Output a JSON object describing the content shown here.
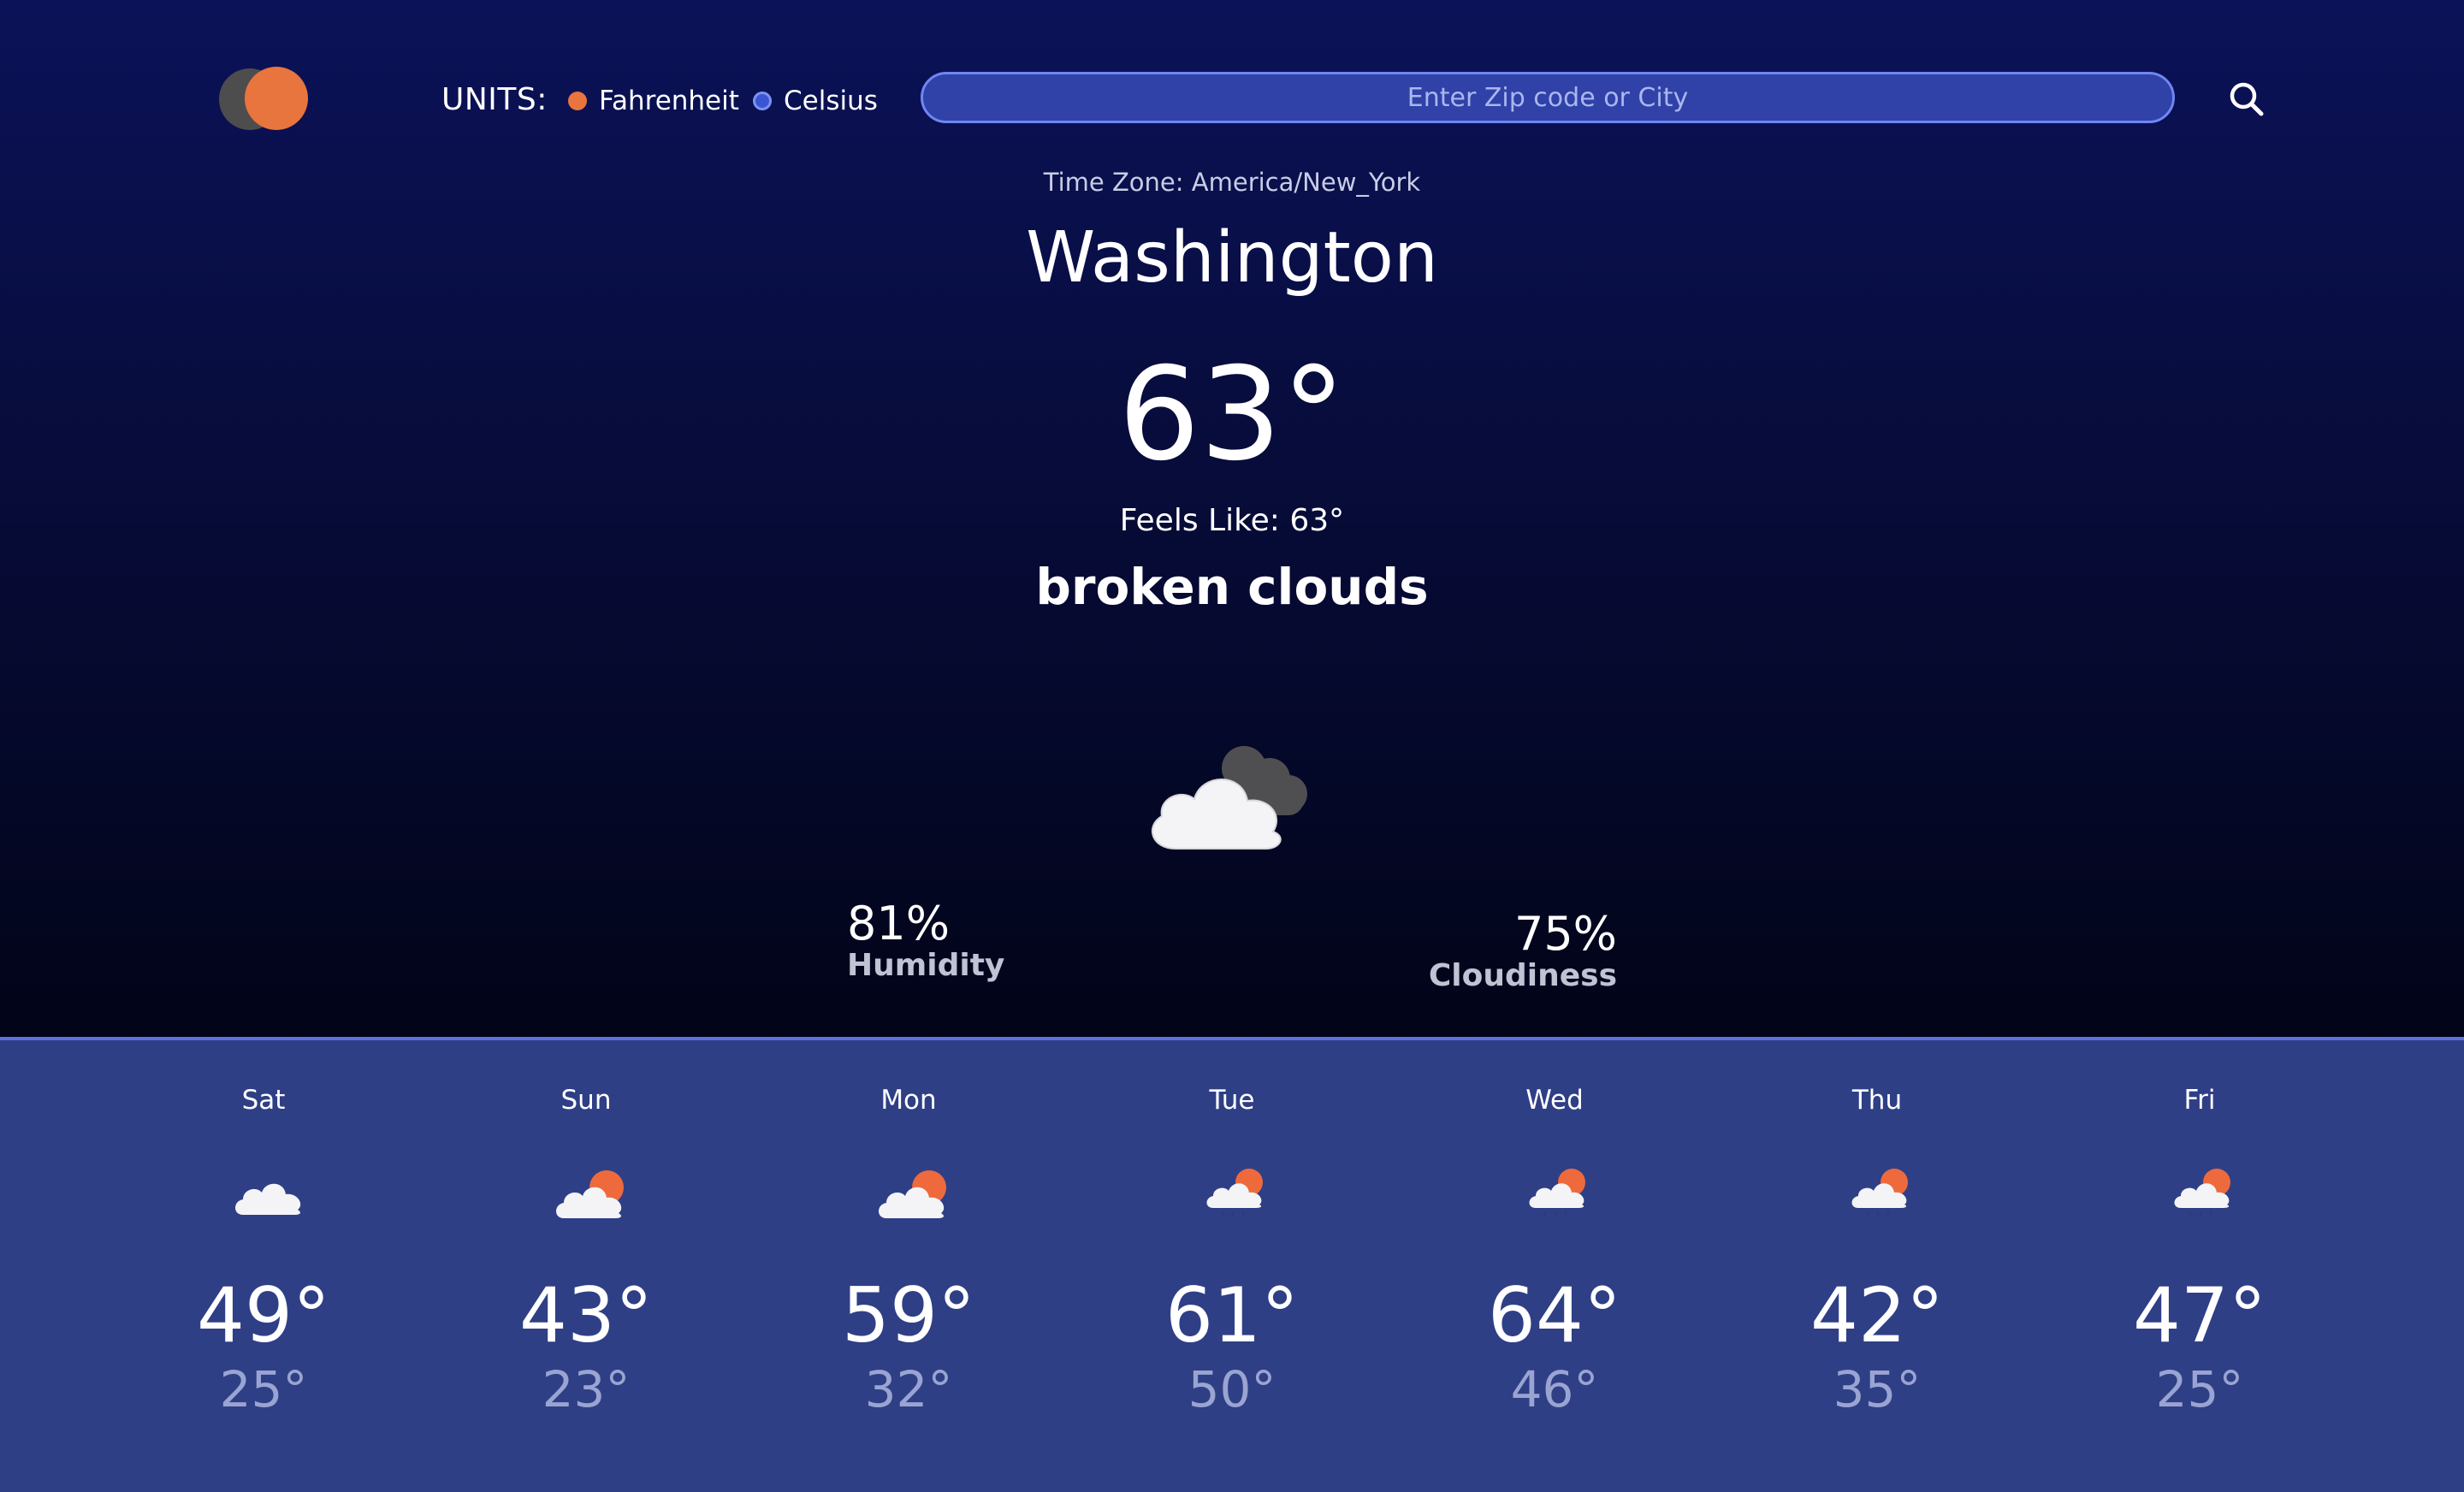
{
  "header": {
    "units_label": "UNITS:",
    "unit_fahrenheit": "Fahrenheit",
    "unit_celsius": "Celsius",
    "selected_unit": "Fahrenheit",
    "search_placeholder": "Enter Zip code or City",
    "search_value": ""
  },
  "current": {
    "timezone": "Time Zone: America/New_York",
    "city": "Washington",
    "temperature": "63°",
    "feels_like": "Feels Like: 63°",
    "description": "broken clouds",
    "icon": "broken-clouds-icon",
    "humidity_value": "81%",
    "humidity_label": "Humidity",
    "cloudiness_value": "75%",
    "cloudiness_label": "Cloudiness"
  },
  "forecast": [
    {
      "day": "Sat",
      "high": "49°",
      "low": "25°",
      "icon": "cloud-icon"
    },
    {
      "day": "Sun",
      "high": "43°",
      "low": "23°",
      "icon": "partly-cloudy-icon"
    },
    {
      "day": "Mon",
      "high": "59°",
      "low": "32°",
      "icon": "partly-cloudy-icon"
    },
    {
      "day": "Tue",
      "high": "61°",
      "low": "50°",
      "icon": "rain-partly-cloudy-icon"
    },
    {
      "day": "Wed",
      "high": "64°",
      "low": "46°",
      "icon": "rain-partly-cloudy-icon"
    },
    {
      "day": "Thu",
      "high": "42°",
      "low": "35°",
      "icon": "rain-partly-cloudy-icon"
    },
    {
      "day": "Fri",
      "high": "47°",
      "low": "25°",
      "icon": "rain-partly-cloudy-icon"
    }
  ],
  "colors": {
    "accent_orange": "#e8743e",
    "accent_blue": "#3a56d4",
    "top_bg": "#0b1258",
    "bottom_bg": "#2f3f86"
  }
}
